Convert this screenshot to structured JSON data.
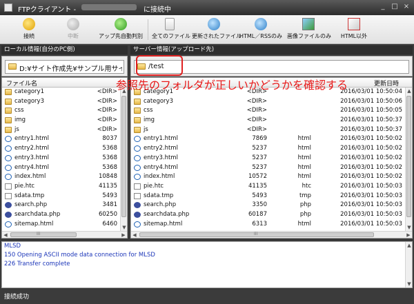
{
  "window": {
    "title_prefix": "FTPクライアント -",
    "title_suffix": "に接続中",
    "buttons": [
      "_",
      "□",
      "×"
    ]
  },
  "toolbar": {
    "connect": "接続",
    "stop": "中断",
    "upload_auto": "アップ先自動判別",
    "all_files": "全てのファイル",
    "updated_files": "更新されたファイル",
    "html_rss": "HTML／RSSのみ",
    "images": "画像ファイルのみ",
    "not_html": "HTML以外"
  },
  "local": {
    "header": "ローカル情報(自分のPC側)",
    "path": "D:¥サイト作成先¥サンプル用サイ",
    "col_name": "ファイル名",
    "files": [
      {
        "name": "category1",
        "size": "<DIR>",
        "type": "folder"
      },
      {
        "name": "category3",
        "size": "<DIR>",
        "type": "folder"
      },
      {
        "name": "css",
        "size": "<DIR>",
        "type": "folder"
      },
      {
        "name": "img",
        "size": "<DIR>",
        "type": "folder"
      },
      {
        "name": "js",
        "size": "<DIR>",
        "type": "folder"
      },
      {
        "name": "entry1.html",
        "size": "8037",
        "type": "html"
      },
      {
        "name": "entry2.html",
        "size": "5368",
        "type": "html"
      },
      {
        "name": "entry3.html",
        "size": "5368",
        "type": "html"
      },
      {
        "name": "entry4.html",
        "size": "5368",
        "type": "html"
      },
      {
        "name": "index.html",
        "size": "10848",
        "type": "html"
      },
      {
        "name": "pie.htc",
        "size": "41135",
        "type": "htc"
      },
      {
        "name": "sdata.tmp",
        "size": "5493",
        "type": "tmp"
      },
      {
        "name": "search.php",
        "size": "3481",
        "type": "php"
      },
      {
        "name": "searchdata.php",
        "size": "60250",
        "type": "php"
      },
      {
        "name": "sitemap.html",
        "size": "6460",
        "type": "html"
      }
    ]
  },
  "remote": {
    "header": "サーバー情報(アップロード先)",
    "path": "/test",
    "col_date": "更新日時",
    "files": [
      {
        "name": "category1",
        "size": "<DIR>",
        "kind": "",
        "date": "2016/03/01 10:50:04",
        "type": "folder"
      },
      {
        "name": "category3",
        "size": "<DIR>",
        "kind": "",
        "date": "2016/03/01 10:50:06",
        "type": "folder"
      },
      {
        "name": "css",
        "size": "<DIR>",
        "kind": "",
        "date": "2016/03/01 10:50:05",
        "type": "folder"
      },
      {
        "name": "img",
        "size": "<DIR>",
        "kind": "",
        "date": "2016/03/01 10:50:37",
        "type": "folder"
      },
      {
        "name": "js",
        "size": "<DIR>",
        "kind": "",
        "date": "2016/03/01 10:50:37",
        "type": "folder"
      },
      {
        "name": "entry1.html",
        "size": "7869",
        "kind": "html",
        "date": "2016/03/01 10:50:02",
        "type": "html"
      },
      {
        "name": "entry2.html",
        "size": "5237",
        "kind": "html",
        "date": "2016/03/01 10:50:02",
        "type": "html"
      },
      {
        "name": "entry3.html",
        "size": "5237",
        "kind": "html",
        "date": "2016/03/01 10:50:02",
        "type": "html"
      },
      {
        "name": "entry4.html",
        "size": "5237",
        "kind": "html",
        "date": "2016/03/01 10:50:02",
        "type": "html"
      },
      {
        "name": "index.html",
        "size": "10572",
        "kind": "html",
        "date": "2016/03/01 10:50:02",
        "type": "html"
      },
      {
        "name": "pie.htc",
        "size": "41135",
        "kind": "htc",
        "date": "2016/03/01 10:50:03",
        "type": "htc"
      },
      {
        "name": "sdata.tmp",
        "size": "5493",
        "kind": "tmp",
        "date": "2016/03/01 10:50:03",
        "type": "tmp"
      },
      {
        "name": "search.php",
        "size": "3350",
        "kind": "php",
        "date": "2016/03/01 10:50:03",
        "type": "php"
      },
      {
        "name": "searchdata.php",
        "size": "60187",
        "kind": "php",
        "date": "2016/03/01 10:50:03",
        "type": "php"
      },
      {
        "name": "sitemap.html",
        "size": "6313",
        "kind": "html",
        "date": "2016/03/01 10:50:03",
        "type": "html"
      }
    ]
  },
  "annotation": "参照先のフォルダが正しいかどうかを確認する",
  "log": [
    "MLSD",
    "150 Opening ASCII mode data connection for MLSD",
    "226 Transfer complete"
  ],
  "status": "接続成功",
  "scroll_glyphs": {
    "up": "▲",
    "down": "▼",
    "left": "◀",
    "right": "▶",
    "grip": "III"
  },
  "colors": {
    "annotation": "#e81818",
    "log_text": "#1a34b8",
    "titlebar": "#3a3a3a"
  }
}
